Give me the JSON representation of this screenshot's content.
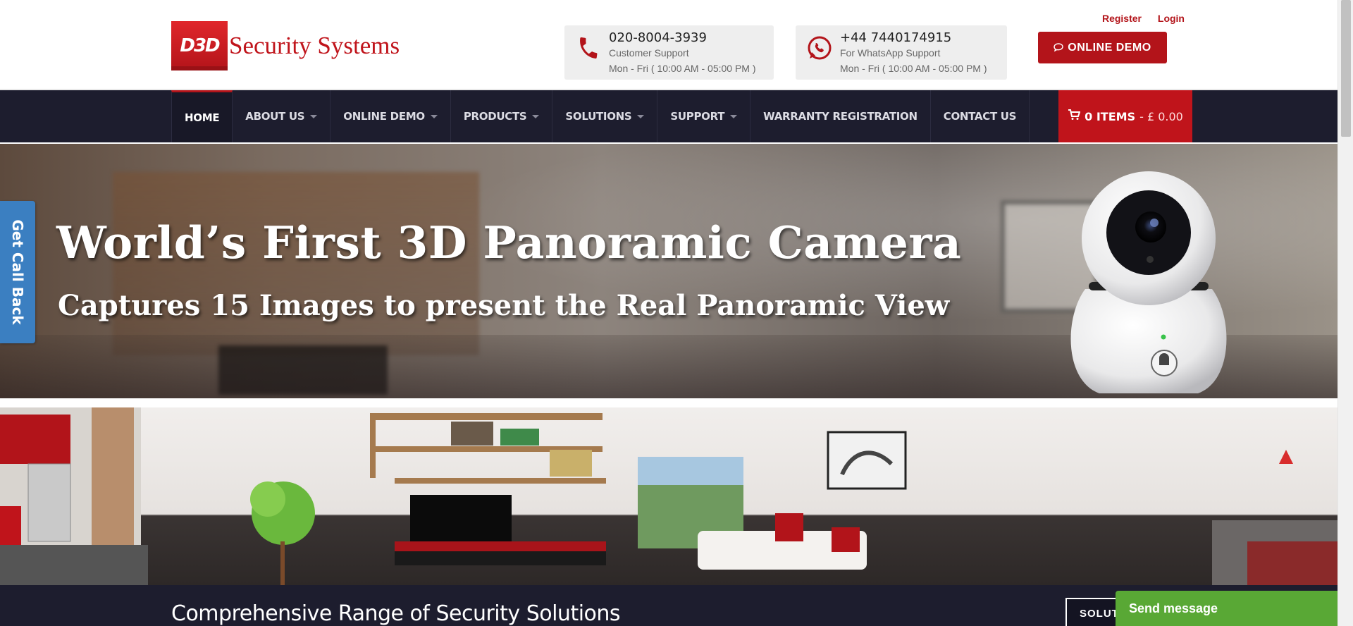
{
  "brand": {
    "badge": "D3D",
    "name": "Security Systems",
    "color": "#c0141b"
  },
  "contacts": {
    "support": {
      "number": "020-8004-3939",
      "label": "Customer Support",
      "hours": "Mon - Fri ( 10:00 AM - 05:00 PM )",
      "icon": "phone-icon"
    },
    "whatsapp": {
      "number": "+44 7440174915",
      "label": "For WhatsApp Support",
      "hours": "Mon - Fri ( 10:00 AM - 05:00 PM )",
      "icon": "whatsapp-icon"
    }
  },
  "top_links": {
    "register": "Register",
    "login": "Login"
  },
  "demo_button": {
    "label": "ONLINE DEMO",
    "icon": "chat-icon"
  },
  "nav": {
    "items": [
      {
        "label": "HOME",
        "active": true,
        "dropdown": false
      },
      {
        "label": "ABOUT US",
        "active": false,
        "dropdown": true
      },
      {
        "label": "ONLINE DEMO",
        "active": false,
        "dropdown": true
      },
      {
        "label": "PRODUCTS",
        "active": false,
        "dropdown": true
      },
      {
        "label": "SOLUTIONS",
        "active": false,
        "dropdown": true
      },
      {
        "label": "SUPPORT",
        "active": false,
        "dropdown": true
      },
      {
        "label": "WARRANTY REGISTRATION",
        "active": false,
        "dropdown": false
      },
      {
        "label": "CONTACT US",
        "active": false,
        "dropdown": false
      }
    ],
    "cart": {
      "items": "0 ITEMS",
      "price": "- £ 0.00",
      "icon": "cart-icon"
    }
  },
  "banner": {
    "title": "World’s First 3D Panoramic Camera",
    "subtitle": "Captures 15 Images to present the Real Panoramic View"
  },
  "section": {
    "title": "Comprehensive Range of Security Solutions",
    "button": "SOLUT"
  },
  "callback": {
    "label": "Get Call Back"
  },
  "chat": {
    "label": "Send message"
  },
  "colors": {
    "accent": "#b3141a",
    "nav_bg": "#1d1d2e",
    "callback": "#3b7fc1",
    "chat": "#59a835"
  }
}
